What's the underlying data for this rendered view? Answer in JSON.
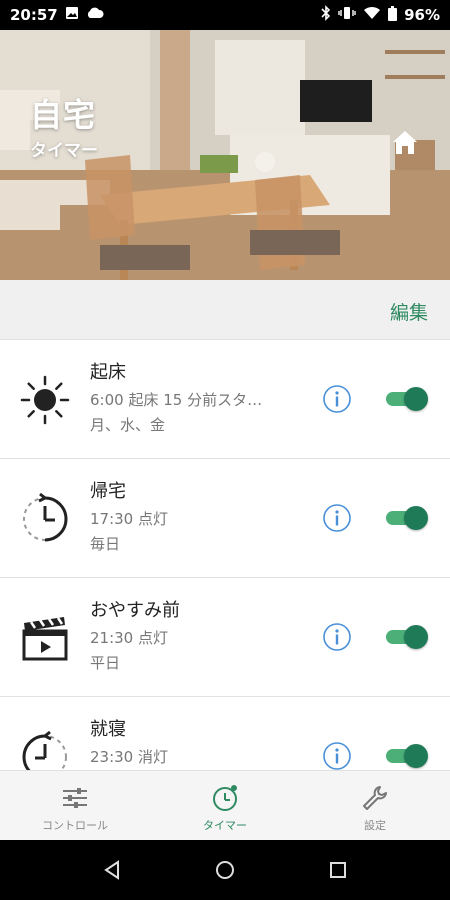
{
  "status_bar": {
    "time": "20:57",
    "battery": "96%",
    "icons": [
      "image-icon",
      "cloud-icon",
      "bluetooth-icon",
      "vibrate-icon",
      "wifi-icon",
      "battery-icon"
    ]
  },
  "header": {
    "title": "自宅",
    "subtitle": "タイマー",
    "home_icon": "home-icon"
  },
  "toolbar": {
    "edit_label": "編集"
  },
  "timers": [
    {
      "name": "起床",
      "detail": "6:00 起床 15 分前スタ…",
      "days": "月、水、金",
      "icon": "sun-icon",
      "enabled": true
    },
    {
      "name": "帰宅",
      "detail": "17:30 点灯",
      "days": "毎日",
      "icon": "timer-clock-icon",
      "enabled": true
    },
    {
      "name": "おやすみ前",
      "detail": "21:30 点灯",
      "days": "平日",
      "icon": "clapperboard-icon",
      "enabled": true
    },
    {
      "name": "就寝",
      "detail": "23:30 消灯",
      "days": "",
      "icon": "timer-clock-icon",
      "enabled": true
    }
  ],
  "bottom_nav": {
    "items": [
      {
        "label": "コントロール",
        "icon": "sliders-icon",
        "active": false
      },
      {
        "label": "タイマー",
        "icon": "timer-icon",
        "active": true
      },
      {
        "label": "設定",
        "icon": "wrench-icon",
        "active": false
      }
    ]
  },
  "colors": {
    "accent": "#2f8a62",
    "toggle_on": "#1f7a58",
    "info": "#4a90d9"
  }
}
